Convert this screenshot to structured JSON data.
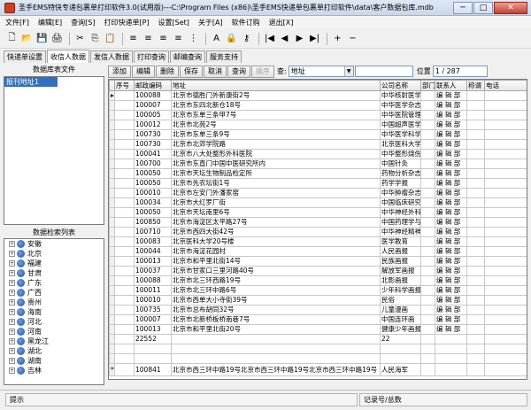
{
  "window": {
    "title": "圣手EMS特快专递包裹单打印软件3.0(试用版)---C:\\Program Files (x86)\\圣手EMS快递单包裹单打印软件\\data\\客户数据包库.mdb",
    "minimize": "─",
    "maximize": "□",
    "close": "✕"
  },
  "menu": [
    "文件[F]",
    "编辑[E]",
    "查询[S]",
    "打印快递单[P]",
    "设置[Set]",
    "关于[A]",
    "软件订购",
    "退出[X]"
  ],
  "toolbar": [
    "new-file-icon",
    "open-folder-icon",
    "save-icon",
    "print-icon",
    "cut-icon",
    "copy-icon",
    "paste-icon",
    "align-left-icon",
    "align-center-icon",
    "align-right-icon",
    "align-justify-icon",
    "distribute-icon",
    "font-icon",
    "lock-icon",
    "key-icon",
    "first-record-icon",
    "prev-record-icon",
    "next-record-icon",
    "last-record-icon",
    "add-record-icon",
    "delete-record-icon"
  ],
  "toolbar_glyphs": {
    "new-file-icon": "🗋",
    "open-folder-icon": "📂",
    "save-icon": "💾",
    "print-icon": "🖨",
    "cut-icon": "✂",
    "copy-icon": "⎘",
    "paste-icon": "📋",
    "align-left-icon": "≡",
    "align-center-icon": "≡",
    "align-right-icon": "≡",
    "align-justify-icon": "≡",
    "distribute-icon": "⋮",
    "font-icon": "A",
    "lock-icon": "🔒",
    "key-icon": "⚷",
    "first-record-icon": "|◀",
    "prev-record-icon": "◀",
    "next-record-icon": "▶",
    "last-record-icon": "▶|",
    "add-record-icon": "+",
    "delete-record-icon": "−"
  },
  "tabs": [
    {
      "label": "快递单设置",
      "active": false
    },
    {
      "label": "收信人数据",
      "active": true
    },
    {
      "label": "发信人数据",
      "active": false
    },
    {
      "label": "打印查询",
      "active": false
    },
    {
      "label": "邮编查询",
      "active": false
    },
    {
      "label": "服务支持",
      "active": false
    }
  ],
  "left": {
    "db_title": "数据库表文件",
    "db_selected": "报刊地址1",
    "tree_title": "数据检索列表",
    "tree_items": [
      "安徽",
      "北京",
      "福建",
      "甘肃",
      "广东",
      "广西",
      "贵州",
      "海南",
      "河北",
      "河南",
      "黑龙江",
      "湖北",
      "湖南",
      "吉林"
    ]
  },
  "actions": {
    "add": "添加",
    "edit": "编辑",
    "delete": "删除",
    "save": "保存",
    "cancel": "取消",
    "query": "查询",
    "sequence": "顺序",
    "search_label": "查:",
    "search_field": "地址",
    "position_label": "位置",
    "position_value": "1 / 287"
  },
  "grid": {
    "columns": [
      "序号",
      "邮政编码",
      "地址",
      "公司名称",
      "部门",
      "联系人",
      "称谓",
      "电话"
    ],
    "rows": [
      [
        "",
        "100088",
        "北京市德胜门外新康街2号",
        "中华核射医学",
        "",
        "编 辑 部",
        "",
        ""
      ],
      [
        "",
        "100007",
        "北京市东四北新仓18号",
        "中华医学杂志",
        "",
        "编 辑 部",
        "",
        ""
      ],
      [
        "",
        "100005",
        "北京市东单三条甲7号",
        "中华医院管理",
        "",
        "编 辑 部",
        "",
        ""
      ],
      [
        "",
        "100012",
        "北京市北苑2号",
        "中国超声医学",
        "",
        "编 辑 部",
        "",
        ""
      ],
      [
        "",
        "100730",
        "北京市东单三条9号",
        "中华医学科学",
        "",
        "编 辑 部",
        "",
        ""
      ],
      [
        "",
        "100730",
        "北京市北郊学院路",
        "北京医科大学",
        "",
        "编 辑 部",
        "",
        ""
      ],
      [
        "",
        "100041",
        "北京市八大处整形外科医院",
        "中华整形烧伤",
        "",
        "编 辑 部",
        "",
        ""
      ],
      [
        "",
        "100700",
        "北京市东直门中国中医研究所内",
        "中国针灸",
        "",
        "编 辑 部",
        "",
        ""
      ],
      [
        "",
        "100050",
        "北京市天坛生物制品检定所",
        "药物分析杂志",
        "",
        "编 辑 部",
        "",
        ""
      ],
      [
        "",
        "100050",
        "北京市先农坛街1号",
        "药学学报",
        "",
        "编 辑 部",
        "",
        ""
      ],
      [
        "",
        "100010",
        "北京市左安门外潘家窑",
        "中华肿瘤杂志",
        "",
        "编 辑 部",
        "",
        ""
      ],
      [
        "",
        "100034",
        "北京市大红罗厂街",
        "中国临床研究",
        "",
        "编 辑 部",
        "",
        ""
      ],
      [
        "",
        "100050",
        "北京市天坛南里6号",
        "中华神经外科",
        "",
        "编 辑 部",
        "",
        ""
      ],
      [
        "",
        "100850",
        "北京市海淀区太平路27号",
        "中国药理学与",
        "",
        "编 辑 部",
        "",
        ""
      ],
      [
        "",
        "100710",
        "北京市西四大街42号",
        "中华神经精神",
        "",
        "编 辑 部",
        "",
        ""
      ],
      [
        "",
        "100083",
        "北京医科大学20号楼",
        "医学教育",
        "",
        "编 辑 部",
        "",
        ""
      ],
      [
        "",
        "100044",
        "北京市海淀花园村",
        "人民画报",
        "",
        "编 辑 部",
        "",
        ""
      ],
      [
        "",
        "100013",
        "北京市和平里北街14号",
        "民族画报",
        "",
        "编 辑 部",
        "",
        ""
      ],
      [
        "",
        "100037",
        "北京市甘家口三里河路40号",
        "解放军画报",
        "",
        "编 辑 部",
        "",
        ""
      ],
      [
        "",
        "100088",
        "北京市北三环西路19号",
        "北影画报",
        "",
        "编 辑 部",
        "",
        ""
      ],
      [
        "",
        "100011",
        "北京市北三环中路6号",
        "少年科学画报",
        "",
        "编 辑 部",
        "",
        ""
      ],
      [
        "",
        "100010",
        "北京市西单大小寺街39号",
        "民俗",
        "",
        "编 辑 部",
        "",
        ""
      ],
      [
        "",
        "100735",
        "北京市总布胡同32号",
        "儿童漫画",
        "",
        "编 辑 部",
        "",
        ""
      ],
      [
        "",
        "100007",
        "北京市北新桥板桥南巷7号",
        "中国连环画",
        "",
        "编 辑 部",
        "",
        ""
      ],
      [
        "",
        "100013",
        "北京市和平里北街20号",
        "健康少年画报",
        "",
        "编 辑 部",
        "",
        ""
      ],
      [
        "",
        "22552",
        "",
        "22",
        "",
        "",
        "",
        ""
      ],
      [
        "",
        "",
        "",
        "",
        "",
        "",
        "",
        ""
      ],
      [
        "",
        "",
        "",
        "",
        "",
        "",
        "",
        ""
      ],
      [
        "",
        "100841",
        "北京市西三环中路19号北京市西三环中路19号北京市西三环中路19号",
        "人民海军",
        "",
        "",
        "",
        ""
      ]
    ],
    "current_row_marker": "▸",
    "new_row_marker": "*"
  },
  "status": {
    "hint": "提示",
    "record_label": "记录号/总数"
  }
}
